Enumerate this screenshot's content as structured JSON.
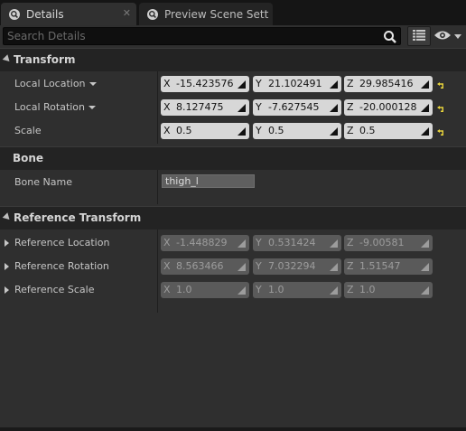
{
  "tabs": [
    {
      "label": "Details",
      "active": true
    },
    {
      "label": "Preview Scene Sett",
      "active": false
    }
  ],
  "search": {
    "placeholder": "Search Details"
  },
  "categories": {
    "transform": {
      "label": "Transform",
      "rows": [
        {
          "label": "Local Location",
          "x": "-15.423576",
          "y": "21.102491",
          "z": "29.985416"
        },
        {
          "label": "Local Rotation",
          "x": "8.127475",
          "y": "-7.627545",
          "z": "-20.000128"
        },
        {
          "label": "Scale",
          "x": "0.5",
          "y": "0.5",
          "z": "0.5"
        }
      ]
    },
    "bone": {
      "label": "Bone",
      "rows": [
        {
          "label": "Bone Name",
          "value": "thigh_l"
        }
      ]
    },
    "reference": {
      "label": "Reference Transform",
      "rows": [
        {
          "label": "Reference Location",
          "x": "-1.448829",
          "y": "0.531424",
          "z": "-9.00581"
        },
        {
          "label": "Reference Rotation",
          "x": "8.563466",
          "y": "7.032294",
          "z": "1.51547"
        },
        {
          "label": "Reference Scale",
          "x": "1.0",
          "y": "1.0",
          "z": "1.0"
        }
      ]
    }
  },
  "axis_labels": {
    "x": "X",
    "y": "Y",
    "z": "Z"
  },
  "colors": {
    "panel_bg": "#2f2f2f",
    "header_bg": "#232323",
    "field_bg": "#d7d7d7",
    "readonly_field_bg": "#5a5a5a",
    "reset_arrow": "#e8d43c"
  }
}
